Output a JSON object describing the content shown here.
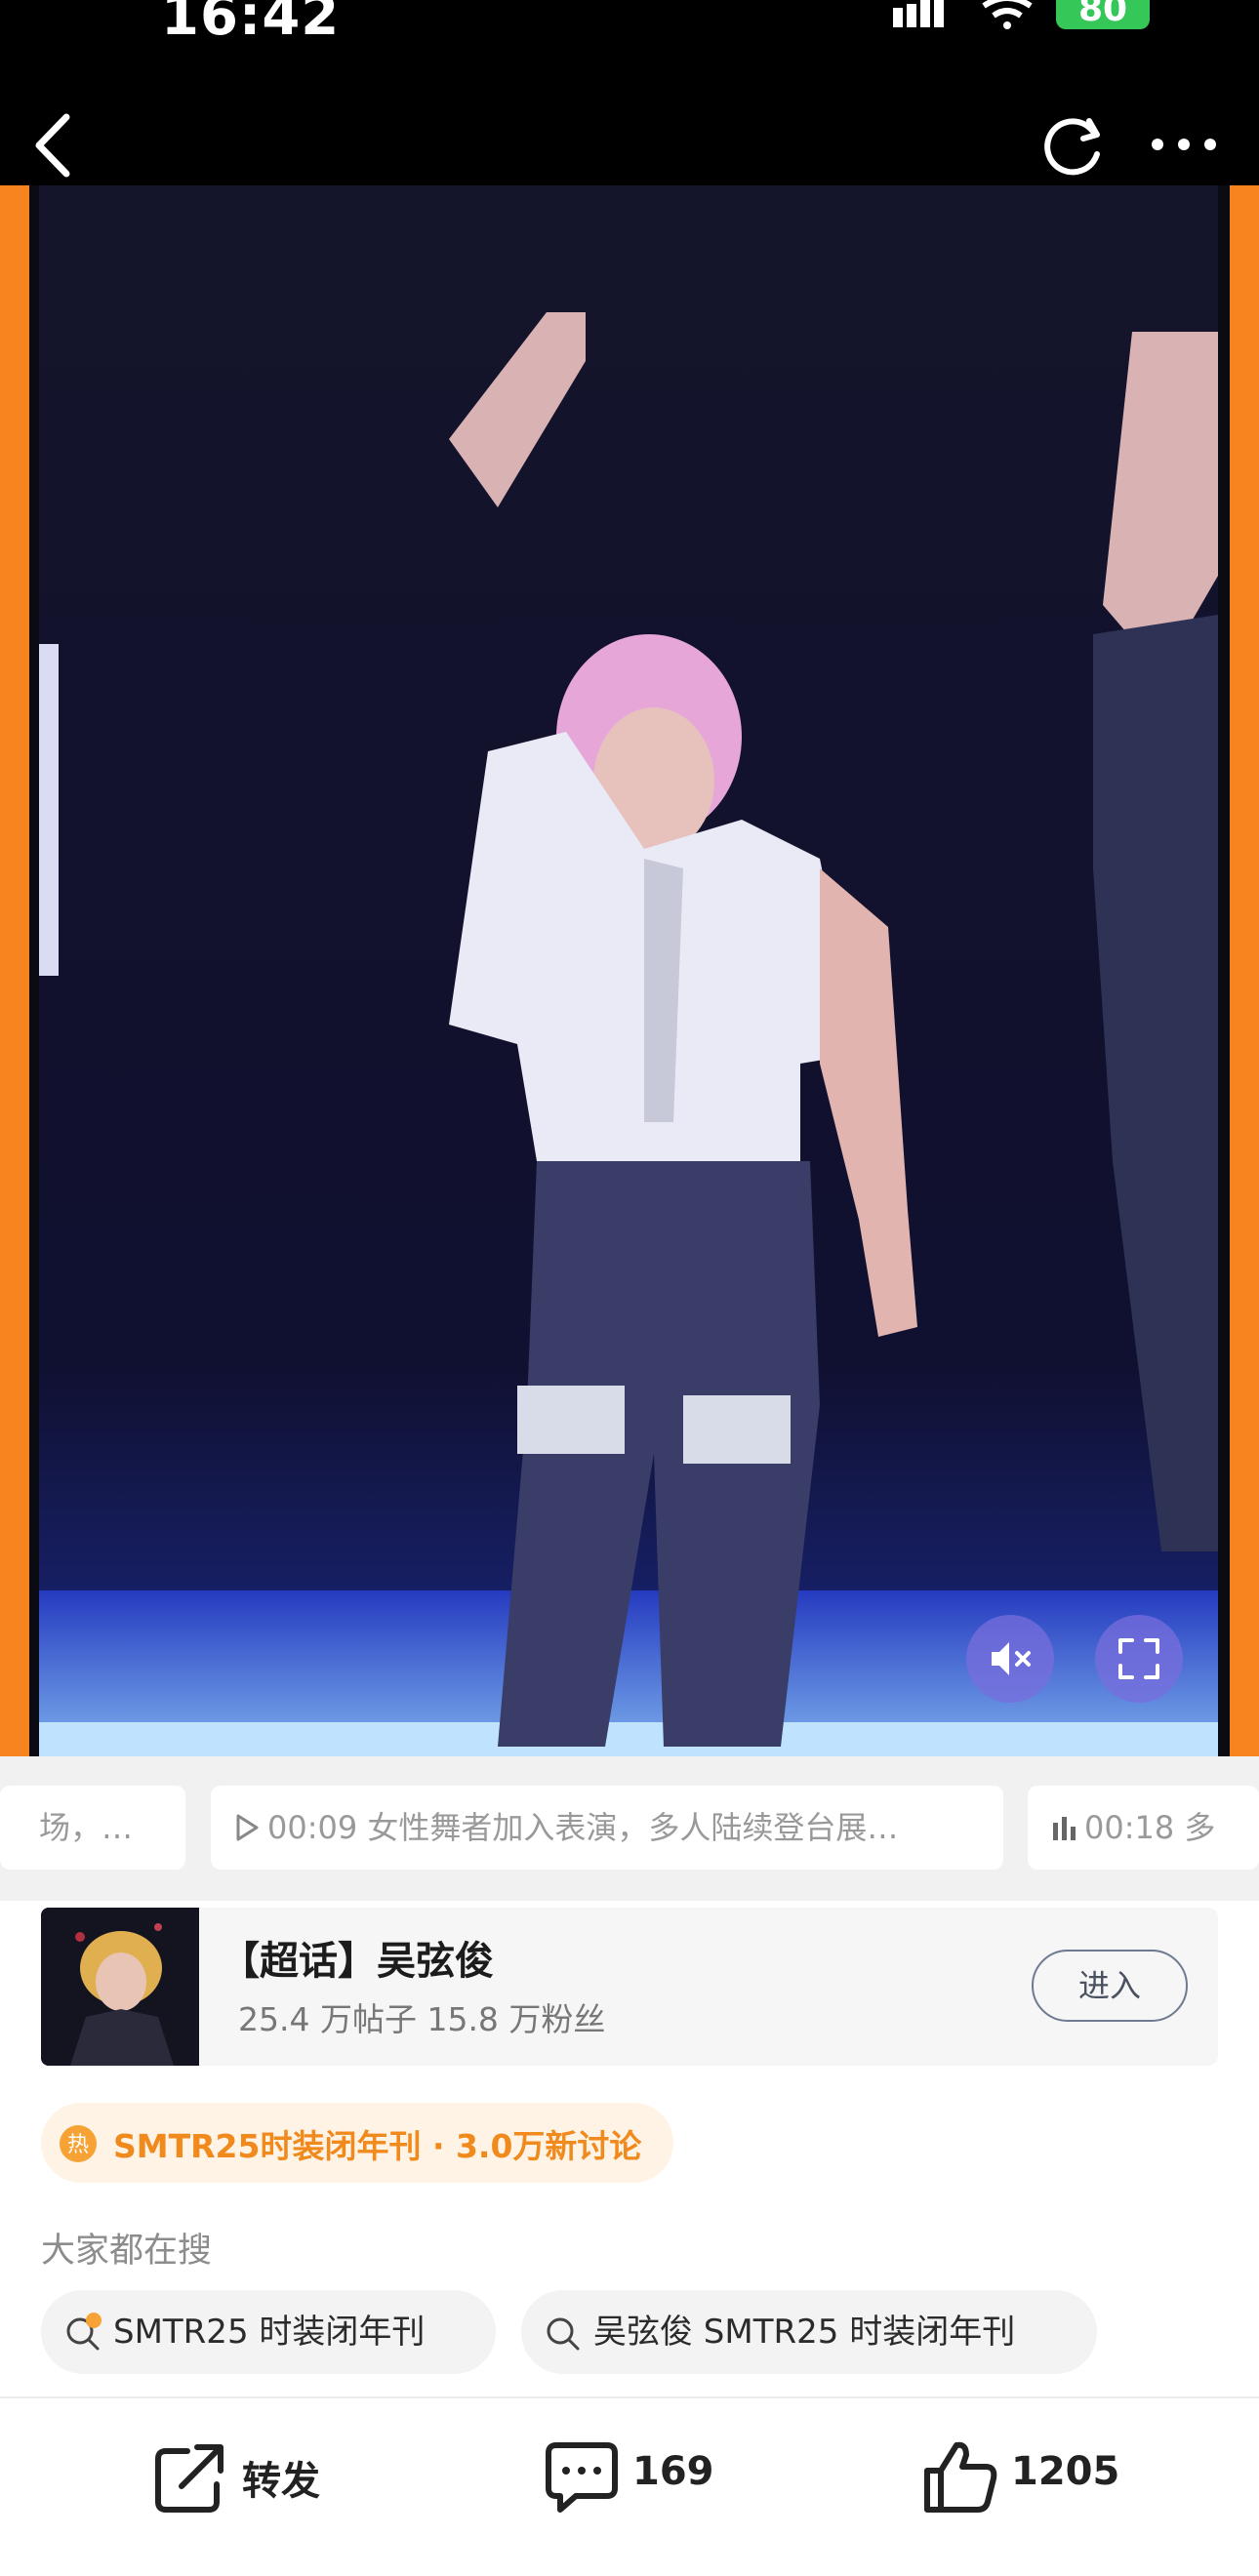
{
  "status_bar": {
    "time": "16:42",
    "battery": "80"
  },
  "video": {
    "chapters": {
      "prev": "场，…",
      "current": "00:09 女性舞者加入表演，多人陆续登台展…",
      "next": "00:18 多"
    }
  },
  "super_topic": {
    "title": "【超话】吴弦俊",
    "stats": "25.4 万帖子 15.8 万粉丝",
    "enter_label": "进入"
  },
  "hot_tag": {
    "icon_text": "热",
    "text": "SMTR25时装闭年刊 · 3.0万新讨论"
  },
  "search": {
    "heading": "大家都在搜",
    "chips": [
      "SMTR25 时装闭年刊",
      "吴弦俊 SMTR25 时装闭年刊"
    ]
  },
  "actions": {
    "share_label": "转发",
    "comment_count": "169",
    "like_count": "1205"
  },
  "colors": {
    "accent_orange": "#f7841e",
    "hot_text": "#f08a1d",
    "control_purple": "#786edc"
  }
}
